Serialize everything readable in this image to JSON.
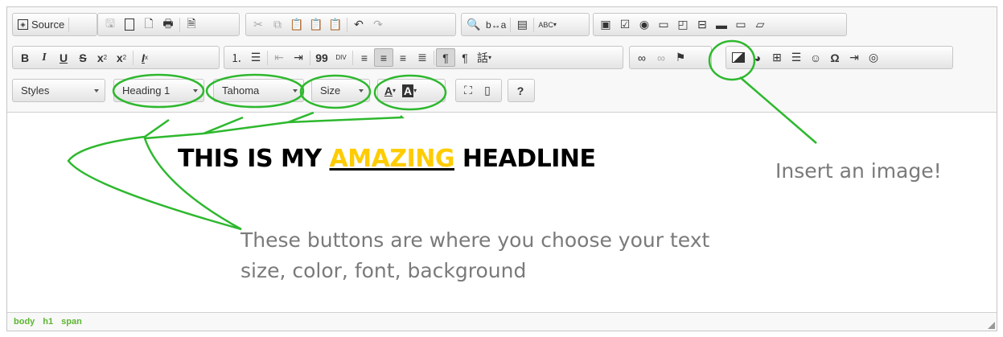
{
  "toolbar": {
    "row1": {
      "source_label": "Source",
      "spell_label": "ABC"
    },
    "row2": {
      "bold": "B",
      "italic": "I",
      "underline": "U",
      "strike": "S",
      "subscript": "x",
      "superscript": "x",
      "remove_format": "I",
      "blockquote": "99",
      "div": "DIV",
      "bidi_ltr": "¶",
      "bidi_rtl": "¶",
      "language": "話",
      "special_char": "Ω"
    },
    "row3": {
      "styles_label": "Styles",
      "format_label": "Heading 1",
      "font_label": "Tahoma",
      "size_label": "Size",
      "text_color_label": "A",
      "bg_color_label": "A",
      "help_label": "?"
    }
  },
  "content": {
    "headline_part1": "THIS IS MY ",
    "headline_amazing": "AMAZING",
    "headline_part2": " HEADLINE",
    "annotation_image": "Insert an image!",
    "annotation_buttons": "These buttons are where you choose your text size, color, font, background"
  },
  "statusbar": {
    "path": [
      "body",
      "h1",
      "span"
    ]
  },
  "colors": {
    "annotation_green": "#2eb82e",
    "highlight_yellow": "#ffcc00",
    "statusbar_text": "#5cb531"
  }
}
